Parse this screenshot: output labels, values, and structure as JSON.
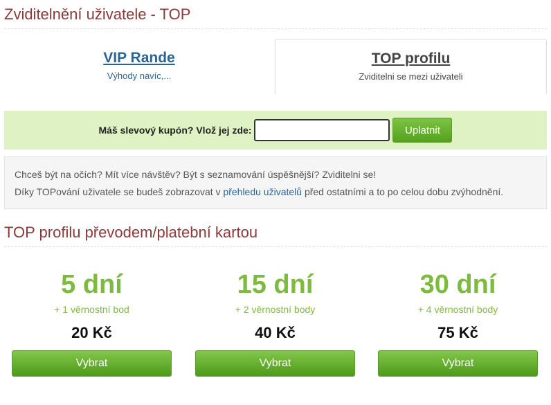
{
  "header": {
    "title": "Zviditelnění uživatele - TOP"
  },
  "tabs": [
    {
      "title": "VIP Rande",
      "subtitle": "Výhody navíc,..."
    },
    {
      "title": "TOP profilu",
      "subtitle": "Zviditelni se mezi uživateli"
    }
  ],
  "coupon": {
    "label": "Máš slevový kupón? Vlož jej zde:",
    "value": "",
    "button": "Uplatnit"
  },
  "info": {
    "line1": "Chceš být na očích? Mít více návštěv? Být s seznamování úspěšnější? Zviditelni se!",
    "line2_before": "Díky TOPování uživatele se budeš zobrazovat v ",
    "line2_link": "přehledu uživatelů",
    "line2_after": " před ostatními a to po celou dobu zvýhodnění."
  },
  "pricing": {
    "title": "TOP profilu převodem/platební kartou",
    "plans": [
      {
        "days": "5 dní",
        "bonus": "+ 1 věrnostní bod",
        "price": "20 Kč",
        "button": "Vybrat"
      },
      {
        "days": "15 dní",
        "bonus": "+ 2 věrnostní body",
        "price": "40 Kč",
        "button": "Vybrat"
      },
      {
        "days": "30 dní",
        "bonus": "+ 4 věrnostní body",
        "price": "75 Kč",
        "button": "Vybrat"
      }
    ]
  },
  "colors": {
    "heading": "#8b3a3a",
    "link": "#2a6496",
    "accent_green": "#7dbb3f",
    "coupon_bg": "#dff2c4"
  }
}
